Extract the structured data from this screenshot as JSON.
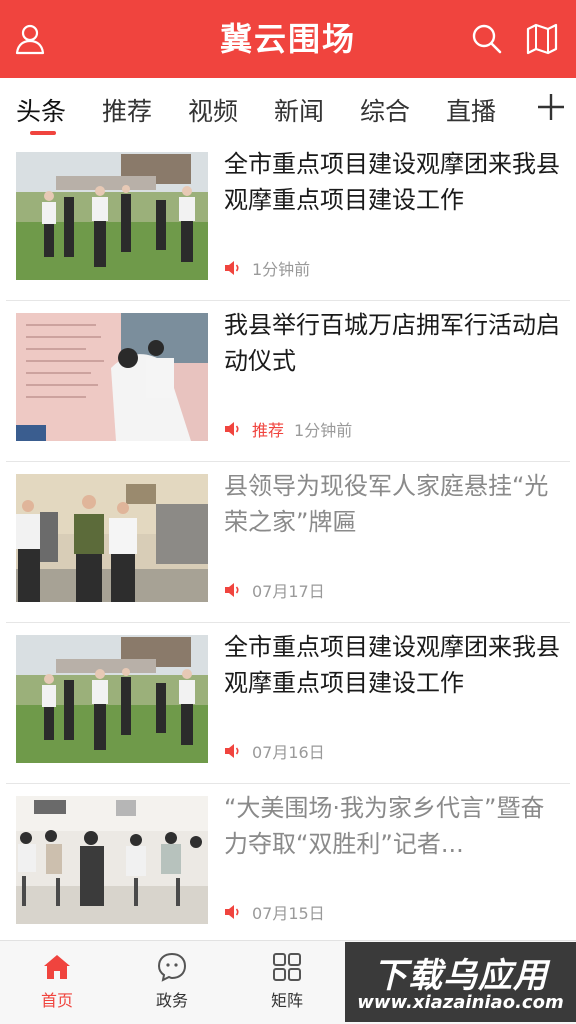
{
  "header": {
    "title": "冀云围场",
    "left_icon": "user-icon",
    "right_icons": [
      "search-icon",
      "map-icon"
    ],
    "background": "#f0443e"
  },
  "tabs": {
    "items": [
      "头条",
      "推荐",
      "视频",
      "新闻",
      "综合",
      "直播"
    ],
    "active": "头条",
    "add_icon": "plus-icon",
    "accent": "#f0443e"
  },
  "news": [
    {
      "title": "全市重点项目建设观摩团来我县观摩重点项目建设工作",
      "tag": "",
      "time": "1分钟前",
      "read": false
    },
    {
      "title": "我县举行百城万店拥军行活动启动仪式",
      "tag": "推荐",
      "time": "1分钟前",
      "read": false
    },
    {
      "title": "县领导为现役军人家庭悬挂“光荣之家”牌匾",
      "tag": "",
      "time": "07月17日",
      "read": true
    },
    {
      "title": "全市重点项目建设观摩团来我县观摩重点项目建设工作",
      "tag": "",
      "time": "07月16日",
      "read": false
    },
    {
      "title": "“大美围场·我为家乡代言”暨奋力夺取“双胜利”记者...",
      "tag": "",
      "time": "07月15日",
      "read": true
    }
  ],
  "bottom_nav": {
    "items": [
      {
        "label": "首页",
        "icon": "home-icon",
        "active": true
      },
      {
        "label": "政务",
        "icon": "chat-bubble-icon",
        "active": false
      },
      {
        "label": "矩阵",
        "icon": "grid-icon",
        "active": false
      }
    ]
  },
  "watermark": {
    "main": "下载乌应用",
    "sub": "www.xiazainiao.com"
  }
}
